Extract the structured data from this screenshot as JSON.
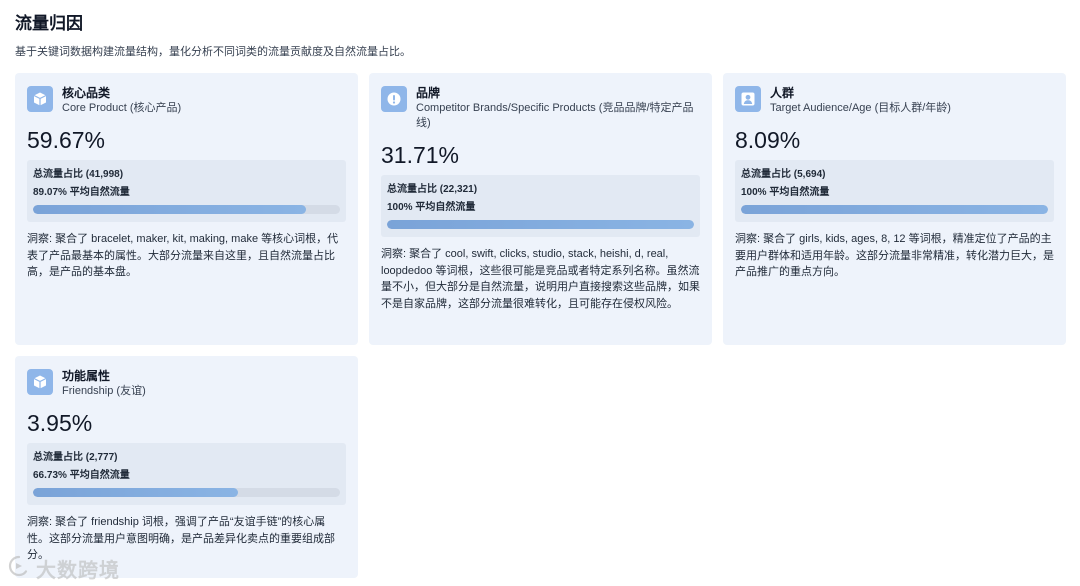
{
  "header": {
    "title": "流量归因",
    "subtitle": "基于关键词数据构建流量结构，量化分析不同词类的流量贡献度及自然流量占比。"
  },
  "cards": [
    {
      "icon": "cube-icon",
      "title": "核心品类",
      "subtitle": "Core Product (核心产品)",
      "percent": "59.67%",
      "total_label": "总流量占比 (41,998)",
      "natural_label": "89.07% 平均自然流量",
      "natural_fraction": 0.8907,
      "insight": "洞察: 聚合了 bracelet, maker, kit, making, make 等核心词根，代表了产品最基本的属性。大部分流量来自这里，且自然流量占比高，是产品的基本盘。"
    },
    {
      "icon": "alert-icon",
      "title": "品牌",
      "subtitle": "Competitor Brands/Specific Products (竞品品牌/特定产品线)",
      "percent": "31.71%",
      "total_label": "总流量占比 (22,321)",
      "natural_label": "100% 平均自然流量",
      "natural_fraction": 1.0,
      "insight": "洞察: 聚合了 cool, swift, clicks, studio, stack, heishi, d, real, loopdedoo 等词根，这些很可能是竞品或者特定系列名称。虽然流量不小，但大部分是自然流量，说明用户直接搜索这些品牌，如果不是自家品牌，这部分流量很难转化，且可能存在侵权风险。"
    },
    {
      "icon": "user-icon",
      "title": "人群",
      "subtitle": "Target Audience/Age (目标人群/年龄)",
      "percent": "8.09%",
      "total_label": "总流量占比 (5,694)",
      "natural_label": "100% 平均自然流量",
      "natural_fraction": 1.0,
      "insight": "洞察: 聚合了 girls, kids, ages, 8, 12 等词根，精准定位了产品的主要用户群体和适用年龄。这部分流量非常精准，转化潜力巨大，是产品推广的重点方向。"
    },
    {
      "icon": "cube-icon",
      "title": "功能属性",
      "subtitle": "Friendship (友谊)",
      "percent": "3.95%",
      "total_label": "总流量占比 (2,777)",
      "natural_label": "66.73% 平均自然流量",
      "natural_fraction": 0.6673,
      "insight": "洞察: 聚合了 friendship 词根，强调了产品“友谊手链”的核心属性。这部分流量用户意图明确，是产品差异化卖点的重要组成部分。"
    }
  ],
  "watermark": {
    "text": "大数跨境"
  }
}
